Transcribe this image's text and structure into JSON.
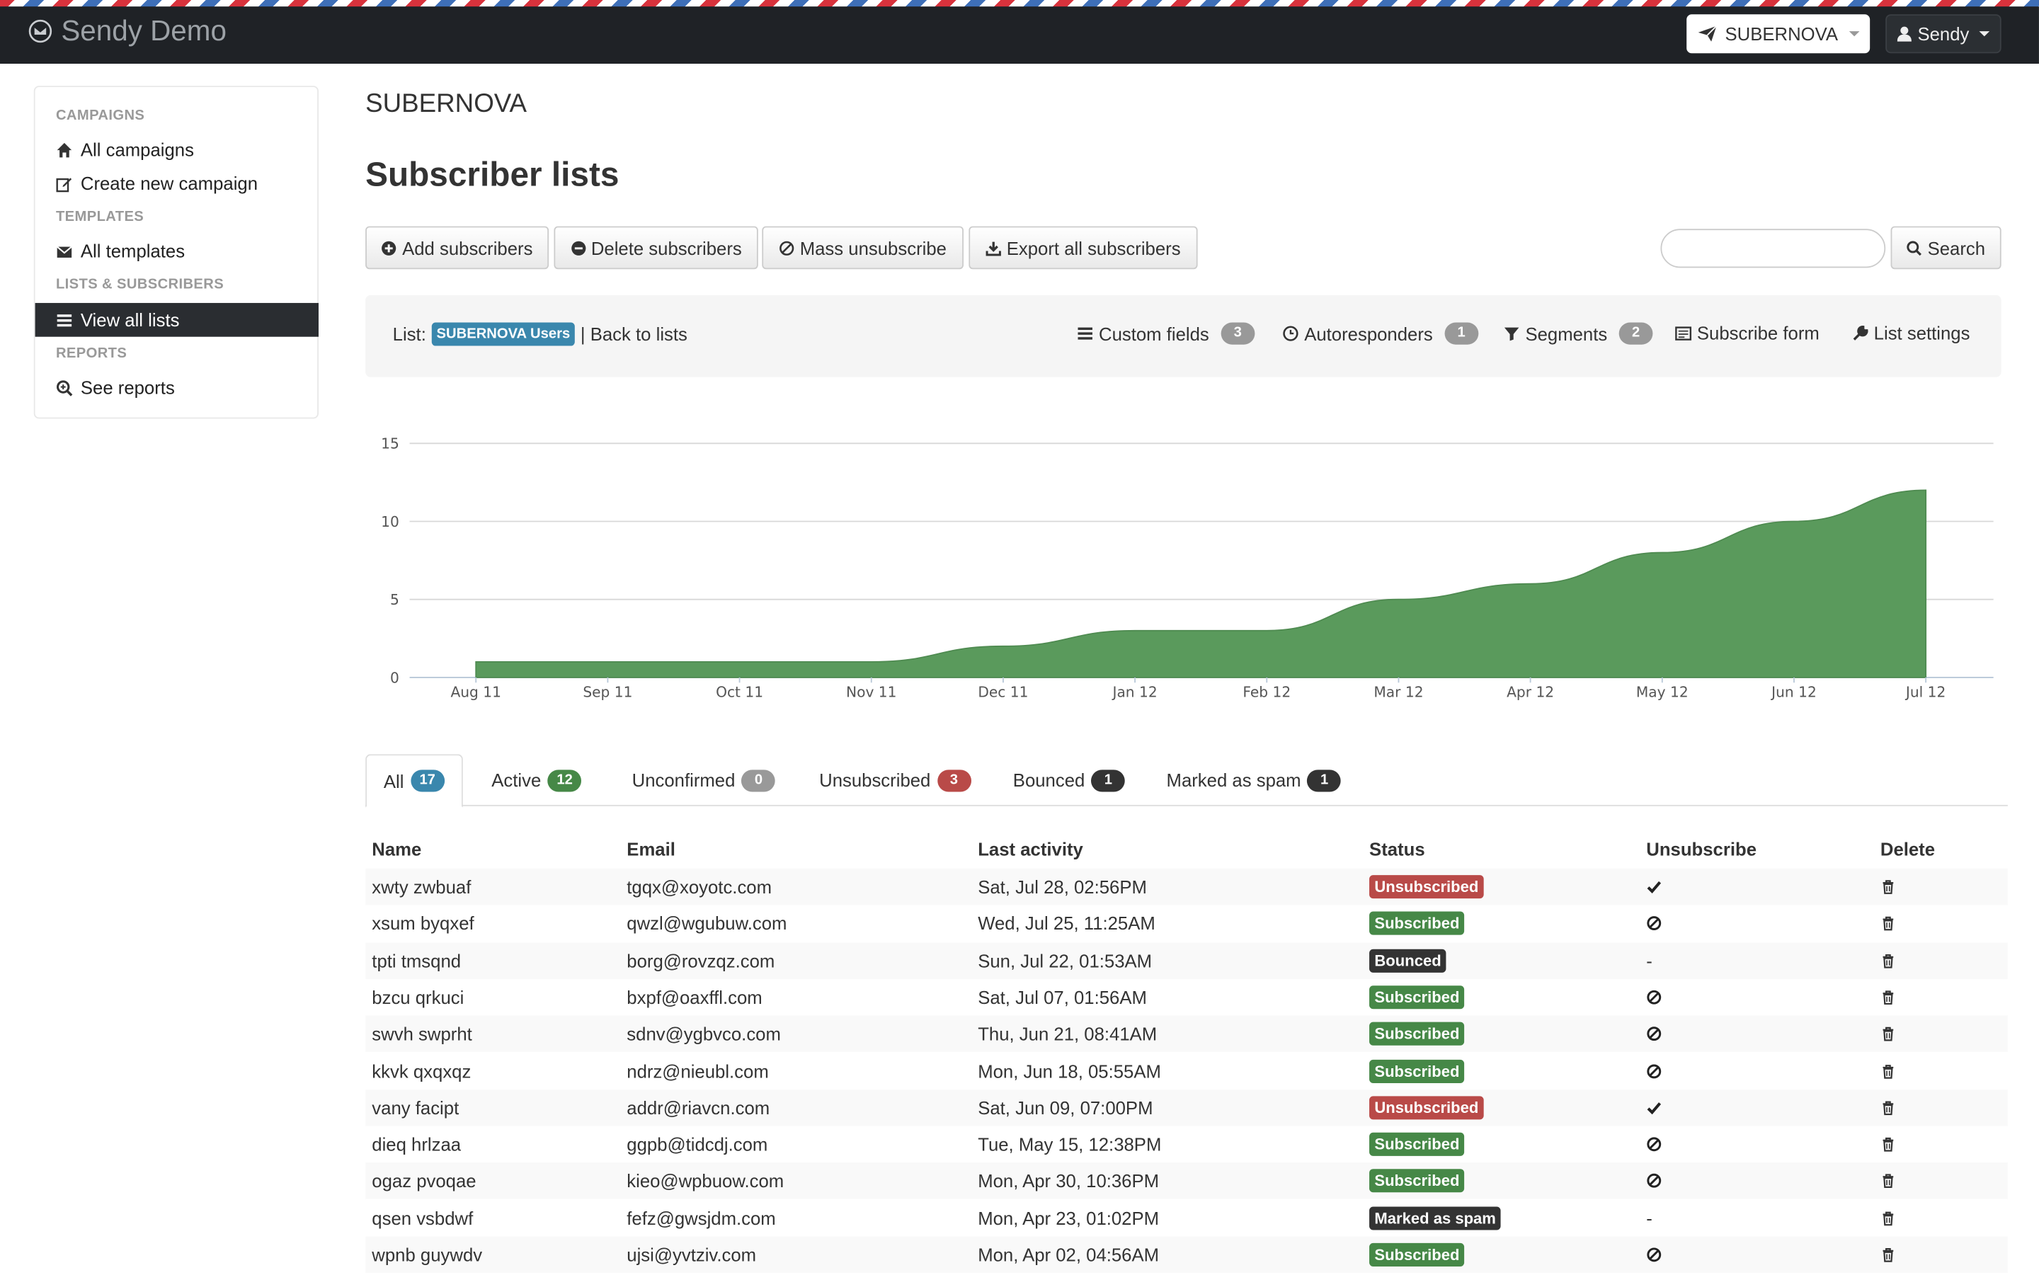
{
  "app": {
    "title": "Sendy Demo"
  },
  "navbar": {
    "list_selector": "SUBERNOVA",
    "user_menu": "Sendy"
  },
  "sidebar": {
    "sections": [
      {
        "header": "CAMPAIGNS",
        "items": [
          "All campaigns",
          "Create new campaign"
        ]
      },
      {
        "header": "TEMPLATES",
        "items": [
          "All templates"
        ]
      },
      {
        "header": "LISTS & SUBSCRIBERS",
        "items": [
          "View all lists"
        ]
      },
      {
        "header": "REPORTS",
        "items": [
          "See reports"
        ]
      }
    ],
    "active_item": "View all lists"
  },
  "page": {
    "list_name": "SUBERNOVA",
    "title": "Subscriber lists"
  },
  "toolbar": {
    "add": "Add subscribers",
    "delete": "Delete subscribers",
    "mass_unsub": "Mass unsubscribe",
    "export": "Export all subscribers",
    "search_value": "",
    "search_button": "Search"
  },
  "listbar": {
    "list_label": "List:",
    "list_badge": "SUBERNOVA Users",
    "back": "| Back to lists",
    "custom_fields": "Custom fields",
    "custom_fields_count": "3",
    "autoresponders": "Autoresponders",
    "autoresponders_count": "1",
    "segments": "Segments",
    "segments_count": "2",
    "subscribe_form": "Subscribe form",
    "list_settings": "List settings"
  },
  "chart_data": {
    "type": "area",
    "title": "",
    "xlabel": "",
    "ylabel": "",
    "x": [
      "Aug 11",
      "Sep 11",
      "Oct 11",
      "Nov 11",
      "Dec 11",
      "Jan 12",
      "Feb 12",
      "Mar 12",
      "Apr 12",
      "May 12",
      "Jun 12",
      "Jul 12"
    ],
    "values": [
      1,
      1,
      1,
      1,
      2,
      3,
      3,
      5,
      6,
      8,
      10,
      12
    ],
    "ylim": [
      0,
      15
    ],
    "yticks": [
      0,
      5,
      10,
      15
    ],
    "grid": true,
    "color": "#5a9a5c"
  },
  "tabs": [
    {
      "label": "All",
      "count": "17",
      "color": "blue"
    },
    {
      "label": "Active",
      "count": "12",
      "color": "green"
    },
    {
      "label": "Unconfirmed",
      "count": "0",
      "color": "grey"
    },
    {
      "label": "Unsubscribed",
      "count": "3",
      "color": "red"
    },
    {
      "label": "Bounced",
      "count": "1",
      "color": "black"
    },
    {
      "label": "Marked as spam",
      "count": "1",
      "color": "black"
    }
  ],
  "table": {
    "headers": [
      "Name",
      "Email",
      "Last activity",
      "Status",
      "Unsubscribe",
      "Delete"
    ],
    "rows": [
      {
        "name": "xwty zwbuaf",
        "email": "tgqx@xoyotc.com",
        "last": "Sat, Jul 28, 02:56PM",
        "status": "Unsubscribed",
        "action": "check"
      },
      {
        "name": "xsum byqxef",
        "email": "qwzl@wgubuw.com",
        "last": "Wed, Jul 25, 11:25AM",
        "status": "Subscribed",
        "action": "ban"
      },
      {
        "name": "tpti tmsqnd",
        "email": "borg@rovzqz.com",
        "last": "Sun, Jul 22, 01:53AM",
        "status": "Bounced",
        "action": "dash"
      },
      {
        "name": "bzcu qrkuci",
        "email": "bxpf@oaxffl.com",
        "last": "Sat, Jul 07, 01:56AM",
        "status": "Subscribed",
        "action": "ban"
      },
      {
        "name": "swvh swprht",
        "email": "sdnv@ygbvco.com",
        "last": "Thu, Jun 21, 08:41AM",
        "status": "Subscribed",
        "action": "ban"
      },
      {
        "name": "kkvk qxqxqz",
        "email": "ndrz@nieubl.com",
        "last": "Mon, Jun 18, 05:55AM",
        "status": "Subscribed",
        "action": "ban"
      },
      {
        "name": "vany facipt",
        "email": "addr@riavcn.com",
        "last": "Sat, Jun 09, 07:00PM",
        "status": "Unsubscribed",
        "action": "check"
      },
      {
        "name": "dieq hrlzaa",
        "email": "ggpb@tidcdj.com",
        "last": "Tue, May 15, 12:38PM",
        "status": "Subscribed",
        "action": "ban"
      },
      {
        "name": "ogaz pvoqae",
        "email": "kieo@wpbuow.com",
        "last": "Mon, Apr 30, 10:36PM",
        "status": "Subscribed",
        "action": "ban"
      },
      {
        "name": "qsen vsbdwf",
        "email": "fefz@gwsjdm.com",
        "last": "Mon, Apr 23, 01:02PM",
        "status": "Marked as spam",
        "action": "dash"
      },
      {
        "name": "wpnb guywdv",
        "email": "ujsi@yvtziv.com",
        "last": "Mon, Apr 02, 04:56AM",
        "status": "Subscribed",
        "action": "ban"
      }
    ]
  },
  "colors": {
    "navbar": "#1f2226",
    "subscribed": "#468847",
    "unsubscribed": "#b94a48",
    "bounced": "#333333",
    "spam": "#333333",
    "info": "#3a87ad"
  }
}
